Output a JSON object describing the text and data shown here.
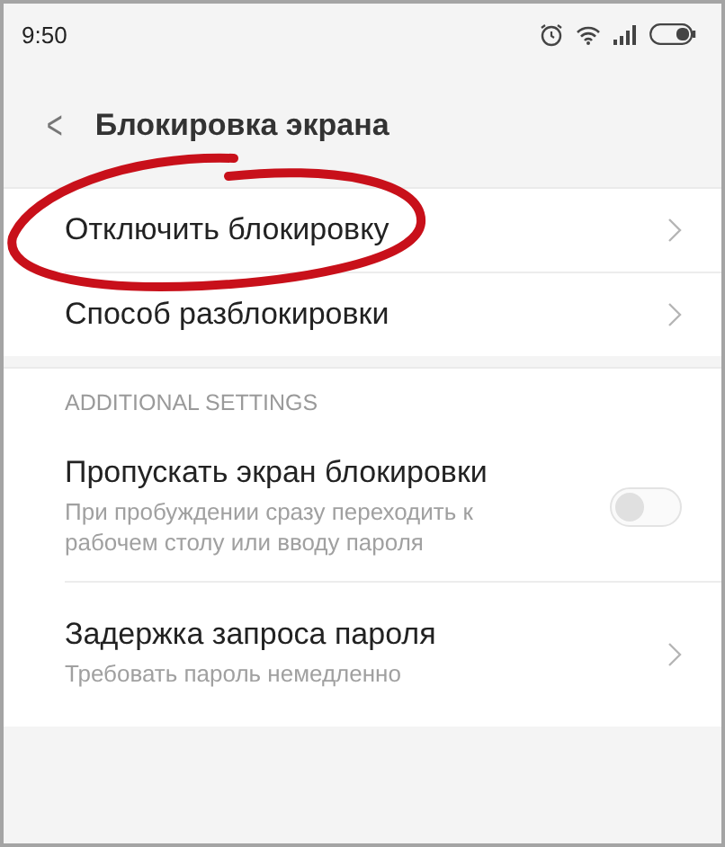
{
  "status_bar": {
    "time": "9:50"
  },
  "header": {
    "back": "<",
    "title": "Блокировка экрана"
  },
  "groups": [
    {
      "items": [
        {
          "kind": "nav",
          "title": "Отключить блокировку"
        },
        {
          "kind": "nav",
          "title": "Способ разблокировки"
        }
      ]
    },
    {
      "heading": "ADDITIONAL SETTINGS",
      "items": [
        {
          "kind": "toggle",
          "title": "Пропускать экран блокировки",
          "subtitle": "При пробуждении сразу переходить к рабочем столу или вводу пароля",
          "on": false
        },
        {
          "kind": "nav",
          "title": "Задержка запроса пароля",
          "subtitle": "Требовать пароль немедленно"
        }
      ]
    }
  ],
  "annotation": {
    "kind": "ellipse"
  }
}
